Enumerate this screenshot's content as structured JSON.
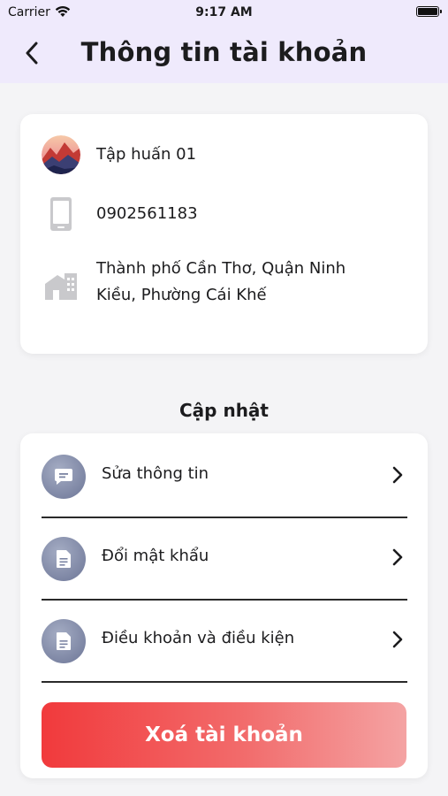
{
  "status_bar": {
    "carrier": "Carrier",
    "time": "9:17 AM"
  },
  "header": {
    "title": "Thông tin tài khoản",
    "back_icon": "chevron-left-icon"
  },
  "account": {
    "name": "Tập huấn 01",
    "phone": "0902561183",
    "address_line1": "Thành phố Cần Thơ, Quận Ninh",
    "address_line2": "Kiều, Phường Cái Khế"
  },
  "update_section": {
    "title": "Cập nhật",
    "items": [
      {
        "label": "Sửa thông tin",
        "icon": "chat-icon"
      },
      {
        "label": "Đổi mật khẩu",
        "icon": "document-icon"
      },
      {
        "label": "Điều khoản và điều kiện",
        "icon": "document-icon"
      }
    ]
  },
  "delete_button": {
    "label": "Xoá tài khoản"
  },
  "colors": {
    "header_bg": "#efeafc",
    "danger": "#f13a3c",
    "icon_circle": "#7b84a3"
  }
}
